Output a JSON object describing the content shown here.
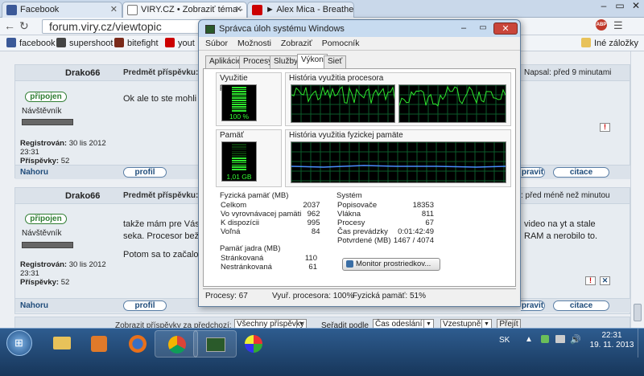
{
  "browser": {
    "tabs": [
      {
        "label": "Facebook",
        "icon": "facebook-icon",
        "color": "#3b5998"
      },
      {
        "label": "VIRY.CZ • Zobraziť téma -",
        "icon": "viry-icon",
        "color": "#222222"
      },
      {
        "label": "► Alex Mica - Breathe (Of",
        "icon": "youtube-icon",
        "color": "#cc0000"
      }
    ],
    "url": "forum.viry.cz/viewtopic",
    "bookmarks": [
      {
        "label": "facebook",
        "color": "#3b5998"
      },
      {
        "label": "supershoot",
        "color": "#444444"
      },
      {
        "label": "bitefight",
        "color": "#7a2a1a"
      },
      {
        "label": "yout",
        "color": "#cc0000"
      }
    ],
    "other_bookmarks": "Iné záložky",
    "abp_badge": "ABP"
  },
  "forum": {
    "posts": [
      {
        "author": "Drako66",
        "subject_label": "Predmět příspěvku:",
        "posted_right": "Napsal: před 9 minutami",
        "status": "připojen",
        "role": "Návštěvník",
        "registered_label": "Registrován:",
        "registered": "30 lis 2012 23:31",
        "posts_label": "Příspěvky:",
        "posts": "52",
        "body": "Ok ale to ste mohli",
        "up": "Nahoru",
        "profile": "profil",
        "reply_partial": "pravit",
        "quote": "citace"
      },
      {
        "author": "Drako66",
        "subject_label": "Predmět příspěvku:",
        "posted_right": ": před méně než minutou",
        "status": "připojen",
        "role": "Návštěvník",
        "registered_label": "Registrován:",
        "registered": "30 lis 2012 23:31",
        "posts_label": "Příspěvky:",
        "posts": "52",
        "body_line1": "takže mám pre Vás s",
        "body_line2": "seka. Procesor beží",
        "body_line3": "Potom sa to začalo a",
        "body_right1": "video na yt a stale",
        "body_right2": "RAM a nerobilo to.",
        "up": "Nahoru",
        "profile": "profil",
        "reply_partial": "pravit",
        "quote": "citace"
      }
    ],
    "filter": {
      "label": "Zobrazit příspěvky za předchozí:",
      "period": "Všechny příspěvky",
      "sort_label": "Seřadit podle",
      "sort_by": "Čas odeslání",
      "order": "Vzestupně",
      "go": "Přejít"
    }
  },
  "taskmanager": {
    "title": "Správca úloh systému Windows",
    "menu": [
      "Súbor",
      "Možnosti",
      "Zobraziť",
      "Pomocník"
    ],
    "tabs": [
      "Aplikácie",
      "Procesy",
      "Služby",
      "Výkon",
      "Sieť"
    ],
    "active_tab": "Výkon",
    "cpu_usage_label": "Využitie procesora",
    "cpu_usage_value": "100 %",
    "cpu_usage_fraction": 1.0,
    "cpu_history_label": "História využitia procesora",
    "memory_label": "Pamäť",
    "memory_value": "1,01 GB",
    "memory_fraction": 0.51,
    "memory_history_label": "História využitia fyzickej pamäte",
    "physical_title": "Fyzická pamäť (MB)",
    "physical": [
      {
        "k": "Celkom",
        "v": "2037"
      },
      {
        "k": "Vo vyrovnávacej pamäti",
        "v": "962"
      },
      {
        "k": "K dispozícii",
        "v": "995"
      },
      {
        "k": "Voľná",
        "v": "84"
      }
    ],
    "kernel_title": "Pamäť jadra (MB)",
    "kernel": [
      {
        "k": "Stránkovaná",
        "v": "110"
      },
      {
        "k": "Nestránkovaná",
        "v": "61"
      }
    ],
    "system_title": "Systém",
    "system": [
      {
        "k": "Popisovače",
        "v": "18353"
      },
      {
        "k": "Vlákna",
        "v": "811"
      },
      {
        "k": "Procesy",
        "v": "67"
      },
      {
        "k": "Čas prevádzky",
        "v": "0:01:42:49"
      },
      {
        "k": "Potvrdené (MB)",
        "v": "1467 / 4074"
      }
    ],
    "resource_monitor": "Monitor prostriedkov...",
    "status_processes": "Procesy: 67",
    "status_cpu": "Vyuř. procesora: 100%",
    "status_memory": "Fyzická pamäť: 51%"
  },
  "taskbar": {
    "lang": "SK",
    "time": "22:31",
    "date": "19. 11. 2013"
  }
}
